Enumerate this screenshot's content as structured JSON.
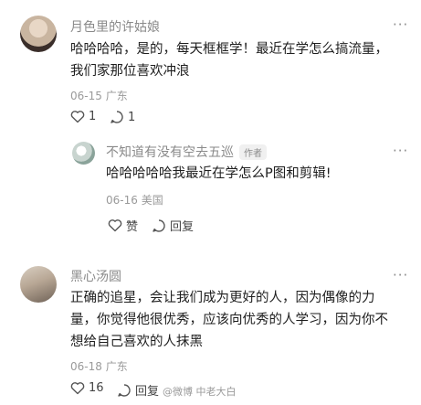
{
  "comments": [
    {
      "author": "月色里的许姑娘",
      "text_line1": "哈哈哈哈，是的，每天框框学！最近在学怎么搞流量，",
      "text_line2": "我们家那位喜欢冲浪",
      "date": "06-15",
      "location": "广东",
      "like_count": "1",
      "reply_count": "1",
      "reply": {
        "author": "不知道有没有空去五巡",
        "badge": "作者",
        "text": "哈哈哈哈哈我最近在学怎么P图和剪辑!",
        "date": "06-16",
        "location": "美国",
        "like_label": "赞",
        "reply_label": "回复"
      }
    },
    {
      "author": "黑心汤圆",
      "text_line1": "正确的追星，会让我们成为更好的人，因为偶像的力",
      "text_line2": "量，你觉得他很优秀，应该向优秀的人学习，因为你不",
      "text_line3": "想给自己喜欢的人抹黑",
      "date": "06-18",
      "location": "广东",
      "like_count": "16",
      "reply_label": "回复"
    }
  ],
  "more_label": "···",
  "watermark": "@微博 中老大白",
  "colors": {
    "text": "#1e1e1e",
    "meta": "#9a9a9a",
    "name": "#8a8a8a"
  }
}
